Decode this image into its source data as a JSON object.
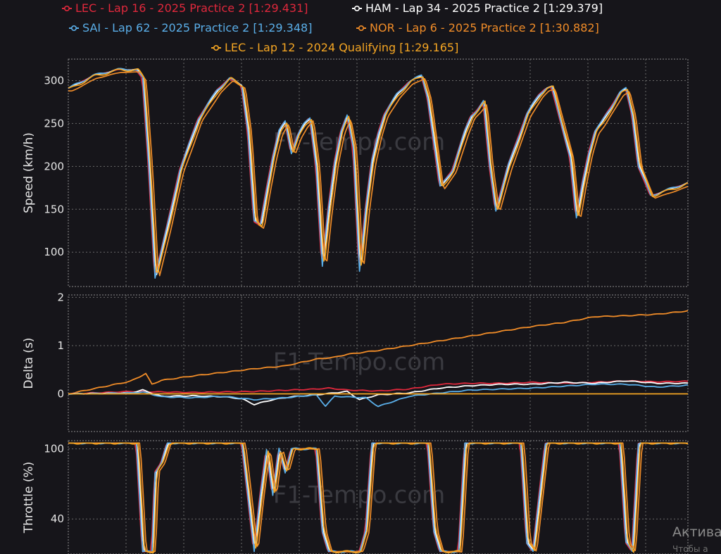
{
  "watermark": "F1-Tempo.com",
  "os_overlay": {
    "title": "Актива",
    "subtitle": "Чтобы а"
  },
  "chart_data": {
    "type": "line",
    "legend": [
      {
        "label": "LEC - Lap 16 - 2025 Practice 2 [1:29.431]",
        "color": "#e0283c"
      },
      {
        "label": "HAM - Lap 34 - 2025 Practice 2 [1:29.379]",
        "color": "#ffffff"
      },
      {
        "label": "SAI - Lap 62 - 2025 Practice 2 [1:29.348]",
        "color": "#5aaee8"
      },
      {
        "label": "NOR - Lap 6 - 2025 Practice 2 [1:30.882]",
        "color": "#f08c28"
      },
      {
        "label": "LEC - Lap 12 - 2024 Qualifying [1:29.165]",
        "color": "#f5a623"
      }
    ],
    "x_range": [
      0,
      100
    ],
    "grid": true,
    "panels": [
      {
        "name": "speed",
        "ylabel": "Speed (km/h)",
        "yticks": [
          100,
          150,
          200,
          250,
          300
        ],
        "ylim": [
          60,
          325
        ],
        "base_series": {
          "x": [
            0,
            4,
            8,
            11,
            12,
            13,
            14,
            16,
            18,
            21,
            24,
            26,
            28,
            29,
            30,
            31,
            32,
            33,
            34,
            35,
            36,
            37,
            38,
            39,
            40,
            41,
            42,
            43,
            44,
            45,
            46,
            47,
            48,
            49,
            50,
            51,
            53,
            55,
            57,
            58,
            60,
            62,
            64,
            65,
            66,
            67,
            68,
            69,
            71,
            73,
            74,
            75,
            76,
            77,
            78,
            81,
            82,
            83,
            84,
            85,
            86,
            87,
            88,
            89,
            90,
            91,
            92,
            94,
            96,
            98,
            100
          ],
          "values": [
            290,
            305,
            312,
            312,
            302,
            200,
            70,
            130,
            195,
            255,
            288,
            302,
            293,
            240,
            135,
            130,
            172,
            210,
            240,
            252,
            215,
            235,
            248,
            256,
            200,
            82,
            150,
            205,
            240,
            258,
            220,
            78,
            150,
            205,
            237,
            260,
            283,
            298,
            305,
            280,
            175,
            195,
            240,
            258,
            265,
            275,
            200,
            148,
            200,
            240,
            260,
            272,
            283,
            290,
            292,
            210,
            138,
            180,
            215,
            240,
            250,
            262,
            273,
            285,
            290,
            260,
            200,
            165,
            170,
            175,
            180
          ]
        }
      },
      {
        "name": "delta",
        "ylabel": "Delta (s)",
        "yticks": [
          0,
          1,
          2
        ],
        "ylim": [
          -0.78,
          2.05
        ],
        "series": [
          {
            "color": "#f08c28",
            "x": [
              0,
              10,
              12.5,
              13.5,
              15,
              20,
              30,
              35,
              40,
              43,
              45,
              50,
              55,
              60,
              65,
              70,
              75,
              80,
              85,
              90,
              95,
              100
            ],
            "values": [
              0,
              0.26,
              0.42,
              0.2,
              0.28,
              0.37,
              0.52,
              0.58,
              0.72,
              0.76,
              0.82,
              0.9,
              1.0,
              1.1,
              1.2,
              1.3,
              1.4,
              1.48,
              1.6,
              1.62,
              1.65,
              1.72
            ]
          },
          {
            "color": "#e0283c",
            "x": [
              0,
              10,
              20,
              30,
              40,
              42,
              45,
              50,
              55,
              60,
              65,
              70,
              75,
              80,
              85,
              90,
              95,
              100
            ],
            "values": [
              0,
              0.05,
              0.03,
              0.05,
              0.1,
              0.12,
              0.08,
              0.06,
              0.1,
              0.2,
              0.22,
              0.22,
              0.24,
              0.22,
              0.24,
              0.27,
              0.25,
              0.26
            ]
          },
          {
            "color": "#ffffff",
            "x": [
              0,
              10,
              12,
              15,
              20,
              25,
              28,
              30,
              33,
              36,
              40,
              45,
              47,
              50,
              55,
              60,
              65,
              70,
              75,
              80,
              85,
              90,
              95,
              100
            ],
            "values": [
              0,
              0.02,
              0.08,
              -0.05,
              -0.04,
              -0.06,
              -0.1,
              -0.22,
              -0.12,
              -0.06,
              -0.02,
              0.05,
              -0.12,
              -0.02,
              0.02,
              0.12,
              0.17,
              0.2,
              0.2,
              0.24,
              0.22,
              0.27,
              0.22,
              0.22
            ]
          },
          {
            "color": "#5aaee8",
            "x": [
              0,
              10,
              12,
              15,
              20,
              25,
              30,
              35,
              40,
              41.5,
              43,
              48,
              50,
              55,
              60,
              65,
              70,
              75,
              80,
              85,
              90,
              95,
              100
            ],
            "values": [
              0,
              0.02,
              0.04,
              -0.06,
              -0.08,
              -0.05,
              -0.12,
              -0.08,
              -0.02,
              -0.25,
              -0.05,
              -0.08,
              -0.26,
              -0.05,
              0.02,
              0.08,
              0.1,
              0.12,
              0.16,
              0.2,
              0.2,
              0.14,
              0.18
            ]
          },
          {
            "color": "#f5a623",
            "x": [
              0,
              100
            ],
            "values": [
              0,
              0
            ]
          }
        ]
      },
      {
        "name": "throttle",
        "ylabel": "Throttle (%)",
        "yticks": [
          40,
          100
        ],
        "ylim": [
          10,
          107
        ],
        "base_series": {
          "x": [
            0,
            11,
            11.5,
            12,
            13.5,
            14,
            15,
            16,
            24,
            25,
            26,
            28,
            29,
            30,
            31,
            32,
            33,
            34,
            35,
            36,
            40,
            41,
            42,
            47,
            48,
            49,
            58,
            59,
            60,
            63,
            64,
            73,
            74,
            75,
            77,
            89,
            90,
            91,
            92,
            100
          ],
          "values": [
            105,
            105,
            60,
            12,
            12,
            80,
            88,
            105,
            105,
            105,
            105,
            105,
            60,
            12,
            60,
            100,
            60,
            100,
            80,
            100,
            100,
            30,
            12,
            12,
            30,
            105,
            105,
            30,
            12,
            12,
            105,
            105,
            20,
            12,
            105,
            105,
            20,
            12,
            105,
            105
          ]
        }
      }
    ]
  }
}
